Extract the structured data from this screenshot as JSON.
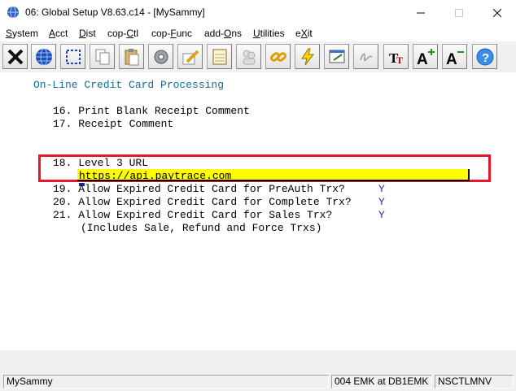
{
  "window": {
    "title": "06: Global Setup V8.63.c14 - [MySammy]"
  },
  "menu": [
    {
      "pre": "",
      "u": "S",
      "post": "ystem"
    },
    {
      "pre": "",
      "u": "A",
      "post": "cct"
    },
    {
      "pre": "",
      "u": "D",
      "post": "ist"
    },
    {
      "pre": "cop-",
      "u": "C",
      "post": "tl"
    },
    {
      "pre": "cop-",
      "u": "F",
      "post": "unc"
    },
    {
      "pre": "add-",
      "u": "O",
      "post": "ns"
    },
    {
      "pre": "",
      "u": "U",
      "post": "tilities"
    },
    {
      "pre": "e",
      "u": "X",
      "post": "it"
    }
  ],
  "toolbar_icons": [
    "close-x-icon",
    "globe-icon",
    "select-icon",
    "copy-icon",
    "paste-icon",
    "settings-icon",
    "edit-pencil-icon",
    "notepad-icon",
    "users-icon",
    "chain-link-icon",
    "lightning-icon",
    "screen-edit-icon",
    "signature-icon",
    "font-tt-icon",
    "font-increase-icon",
    "font-decrease-icon",
    "help-icon"
  ],
  "screen": {
    "heading": "On-Line Credit Card Processing",
    "item16": "16. Print Blank Receipt Comment",
    "item17": "17. Receipt Comment",
    "item18_label": "18. Level 3 URL",
    "item18_value": "https://api.paytrace.com",
    "item19": "19. Allow Expired Credit Card for PreAuth Trx?",
    "item19_value": "Y",
    "item20": "20. Allow Expired Credit Card for Complete Trx?",
    "item20_value": "Y",
    "item21": "21. Allow Expired Credit Card for Sales Trx?",
    "item21_value": "Y",
    "item21_note": "(Includes Sale, Refund and Force Trxs)"
  },
  "status": {
    "company": "MySammy",
    "user_db": "004 EMK at DB1EMK",
    "code": "NSCTLMNV"
  },
  "colors": {
    "highlight_box": "#e8182a",
    "field_bg": "#ffff00",
    "heading": "#0f6e9c",
    "values": "#1a26b0"
  }
}
